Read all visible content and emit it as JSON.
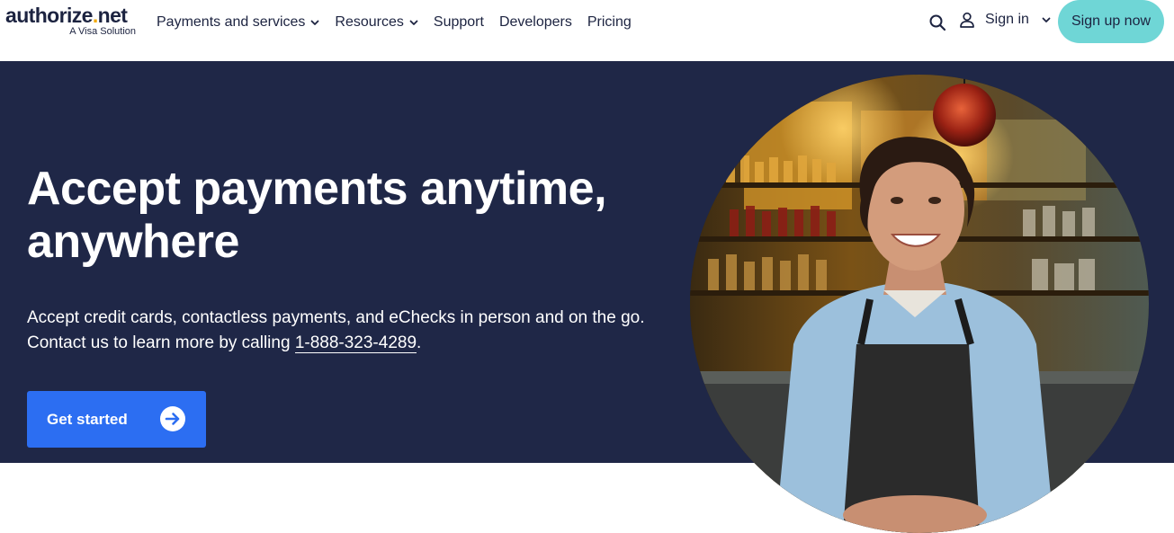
{
  "brand": {
    "name_main": "authorize",
    "name_dot": ".",
    "name_tld": "net",
    "tagline": "A Visa Solution",
    "accent": "#f2a900",
    "navy": "#1c2340"
  },
  "nav": {
    "items": [
      {
        "label": "Payments and services",
        "has_dropdown": true
      },
      {
        "label": "Resources",
        "has_dropdown": true
      },
      {
        "label": "Support",
        "has_dropdown": false
      },
      {
        "label": "Developers",
        "has_dropdown": false
      },
      {
        "label": "Pricing",
        "has_dropdown": false
      }
    ]
  },
  "header_right": {
    "search_icon": "search-icon",
    "user_icon": "user-icon",
    "signin_label": "Sign in",
    "signup_label": "Sign up now",
    "signup_color": "#6fd6d6"
  },
  "hero": {
    "background": "#1f2747",
    "title": "Accept payments anytime, anywhere",
    "body_text": "Accept credit cards, contactless payments, and eChecks in person and on the go. Contact us to learn more by calling ",
    "phone": "1-888-323-4289",
    "body_end": ".",
    "cta_label": "Get started",
    "cta_color": "#2c6ef2",
    "cta_icon": "arrow-right-circle-icon"
  },
  "photo": {
    "description_icon": "smiling-woman-bar-photo"
  }
}
